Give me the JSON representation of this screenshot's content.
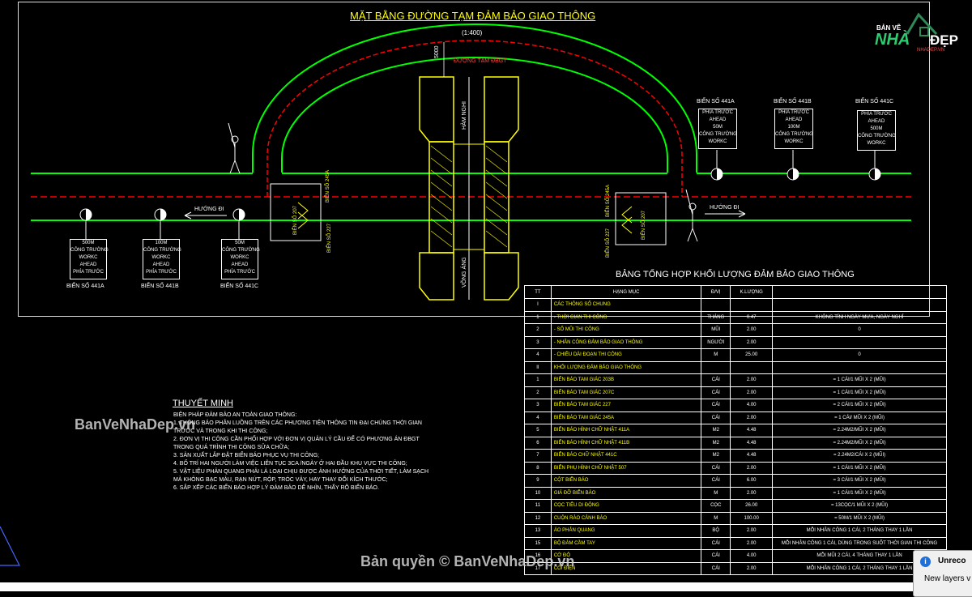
{
  "drawing": {
    "title": "MẶT BẰNG ĐƯỜNG TẠM ĐẢM BẢO GIAO THÔNG",
    "scale": "(1:400)",
    "road_label": "ĐƯỜNG TẠM ĐBGT",
    "dim_label": "5000",
    "ham_nghi": "HÀM NGHI",
    "vong_ang": "VÕNG ÁNG",
    "huong_di_left": "HƯỚNG ĐI",
    "huong_di_right": "HƯỚNG ĐI",
    "left_signs": [
      {
        "lines": [
          "500M",
          "CÔNG TRƯỜNG",
          "WORKC",
          "AHEAD",
          "PHÍA TRƯỚC"
        ],
        "caption": "BIỂN SỐ 441A"
      },
      {
        "lines": [
          "100M",
          "CÔNG TRƯỜNG",
          "WORKC",
          "AHEAD",
          "PHÍA TRƯỚC"
        ],
        "caption": "BIỂN SỐ 441B"
      },
      {
        "lines": [
          "50M",
          "CÔNG TRƯỜNG",
          "WORKC",
          "AHEAD",
          "PHÍA TRƯỚC"
        ],
        "caption": "BIỂN SỐ 441C"
      }
    ],
    "right_signs": [
      {
        "caption": "BIỂN SỐ 441A",
        "lines": [
          "PHÍA TRƯỚC",
          "AHEAD",
          "50M",
          "CÔNG TRƯỜNG",
          "WORKC"
        ]
      },
      {
        "caption": "BIỂN SỐ 441B",
        "lines": [
          "PHÍA TRƯỚC",
          "AHEAD",
          "100M",
          "CÔNG TRƯỜNG",
          "WORKC"
        ]
      },
      {
        "caption": "BIỂN SỐ 441C",
        "lines": [
          "PHÍA TRƯỚC",
          "AHEAD",
          "500M",
          "CÔNG TRƯỜNG",
          "WORKC"
        ]
      }
    ],
    "vertical_labels": [
      "BIỂN SỐ 245A",
      "BIỂN SỐ 227",
      "BIỂN SỐ 207",
      "BIỂN SỐ 227",
      "BIỂN SỐ 207",
      "BIỂN SỐ 245A"
    ]
  },
  "notes": {
    "title": "THUYẾT MINH",
    "lines": [
      "BIỆN PHÁP ĐẢM BẢO AN TOÀN GIAO THÔNG:",
      "1.    THÔNG BÁO PHÂN LUỒNG TRÊN CÁC PHƯƠNG TIỆN THÔNG TIN ĐẠI CHÚNG THỜI GIAN",
      "       TRƯỚC VÀ TRONG KHI THI CÔNG;",
      "2.    ĐƠN VỊ THI CÔNG CẦN PHỐI HỢP VỚI ĐƠN VỊ QUẢN LÝ CẦU ĐỂ CÓ PHƯƠNG ÁN ĐBGT",
      "       TRONG QUÁ TRÌNH THI CÔNG SỬA CHỮA;",
      "3.    SẢN XUẤT LẮP ĐẶT BIỂN BÁO PHỤC VỤ THI CÔNG;",
      "4.    BỐ TRÍ HAI NGƯỜI LÀM VIỆC LIÊN TỤC 3CA /NGÀY Ở HAI ĐẦU KHU VỰC THI CÔNG;",
      "5.    VẬT LIỆU PHẢN QUANG PHẢI LÀ LOẠI CHỊU ĐƯỢC ẢNH HƯỞNG CỦA THỜI TIẾT, LÀM SẠCH",
      "       MÀ KHÔNG BẠC MÀU, RẠN NỨT, RỘP, TRÓC VẢY, HAY THAY ĐỔI KÍCH THƯỚC;",
      "6.    SẮP XẾP CÁC BIỂN BÁO HỢP LÝ ĐẢM BẢO DỄ NHÌN, THẤY RÕ BIỂN BÁO."
    ]
  },
  "table": {
    "title": "BẢNG TỔNG HỢP KHỐI LƯỢNG ĐẢM BẢO GIAO THÔNG",
    "headers": [
      "TT",
      "HẠNG MỤC",
      "Đ/VỊ",
      "K.LƯỢNG",
      ""
    ],
    "rows": [
      [
        "I",
        "CÁC THÔNG SỐ CHUNG",
        "",
        "",
        ""
      ],
      [
        "1",
        "  - THỜI GIAN THI CÔNG",
        "THÁNG",
        "0.47",
        "KHÔNG TÍNH NGÀY MƯA, NGÀY NGHỈ"
      ],
      [
        "2",
        "  - SỐ MŨI THI CÔNG",
        "MŨI",
        "2.00",
        "0"
      ],
      [
        "3",
        "  - NHÂN CÔNG ĐẢM BẢO GIAO THÔNG",
        "NGƯỜI",
        "2.00",
        ""
      ],
      [
        "4",
        "  - CHIỀU DÀI ĐOẠN THI CÔNG",
        "M",
        "25.00",
        "0"
      ],
      [
        "II",
        "KHỐI LƯỢNG ĐẢM BẢO GIAO THÔNG",
        "",
        "",
        ""
      ],
      [
        "1",
        "BIỂN BÁO TAM GIÁC 203B",
        "CÁI",
        "2.00",
        "= 1 CÁI/1 MŨI X 2 (MŨI)"
      ],
      [
        "2",
        "BIỂN BÁO TAM GIÁC 207C",
        "CÁI",
        "2.00",
        "= 1 CÁI/1 MŨI X 2 (MŨI)"
      ],
      [
        "3",
        "BIỂN BÁO TAM GIÁC 227",
        "CÁI",
        "4.00",
        "= 2 CÁI/1 MŨI X 2 (MŨI)"
      ],
      [
        "4",
        "BIỂN BÁO TAM GIÁC 245A",
        "CÁI",
        "2.00",
        "= 1 CÁI/ MŨI X 2 (MŨI)"
      ],
      [
        "5",
        "BIỂN BÁO HÌNH CHỮ NHẬT 411A",
        "M2",
        "4.48",
        "= 2.24M2/MŨI X 2 (MŨI)"
      ],
      [
        "6",
        "BIỂN BÁO HÌNH CHỮ NHẬT 411B",
        "M2",
        "4.48",
        "= 2.24M2/MŨI X 2 (MŨI)"
      ],
      [
        "7",
        "BIỂN BÁO CHỮ NHẬT 441C",
        "M2",
        "4.48",
        "= 2.24M2/CÁI X 2 (MŨI)"
      ],
      [
        "8",
        "BIỂN PHỤ HÌNH CHỮ NHẬT 507",
        "CÁI",
        "2.00",
        "= 1 CÁI/1 MŨI X 2 (MŨI)"
      ],
      [
        "9",
        "CỘT BIỂN BÁO",
        "CÁI",
        "6.00",
        "= 3 CÁI/1 MŨI X 2 (MŨI)"
      ],
      [
        "10",
        "GIÁ ĐỠ BIỂN BÁO",
        "M",
        "2.00",
        "= 1 CÁI/1 MŨI X 2 (MŨI)"
      ],
      [
        "11",
        "CỌC TIÊU DI ĐỘNG",
        "CỌC",
        "26.00",
        "= 13CỌC/1 MŨI X 2 (MŨI)"
      ],
      [
        "12",
        "CUỘN RÀO CẢNH BÁO",
        "M",
        "100.00",
        "= 50M/1 MŨI X 2 (MŨI)"
      ],
      [
        "13",
        "ÁO PHẢN QUANG",
        "BỘ",
        "2.00",
        "MỖI NHÂN CÔNG 1 CÁI, 2 THÁNG THAY 1 LẦN"
      ],
      [
        "15",
        "BỘ ĐÀM CẦM TAY",
        "CÁI",
        "2.00",
        "MỖI NHÂN CÔNG 1 CÁI, DÙNG TRONG SUỐT THỜI GIAN THI CÔNG"
      ],
      [
        "16",
        "CỜ ĐỎ",
        "CÁI",
        "4.00",
        "MỖI MŨI 2 CÁI, 4 THÁNG THAY 1 LẦN"
      ],
      [
        "17",
        "CÒI ĐIỆN",
        "CÁI",
        "2.00",
        "MỖI NHÂN CÔNG 1 CÁI, 2 THÁNG THAY 1 LẦN"
      ]
    ]
  },
  "watermarks": {
    "side": "BanVeNhaDep.vn",
    "bottom": "Bản quyền © BanVeNhaDep.vn"
  },
  "logo": {
    "top": "BẢN VẼ",
    "main": "NHÀ",
    "accent": "ĐẸP",
    "sub": "NHADEP.VN"
  },
  "tooltip": {
    "title": "Unreco",
    "body": "New layers v"
  },
  "colors": {
    "background": "#000000",
    "road": "#00ff00",
    "centerline": "#ff0000",
    "yellow": "#ffff00",
    "line": "#ffffff"
  }
}
